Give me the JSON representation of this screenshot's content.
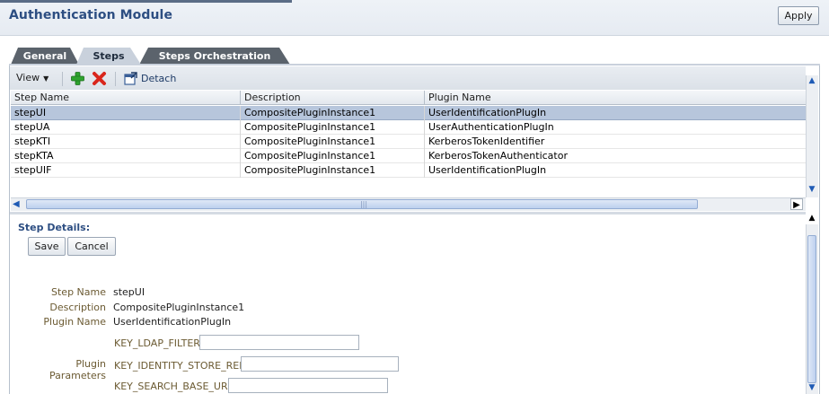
{
  "header": {
    "title": "Authentication Module",
    "apply_label": "Apply"
  },
  "tabs": [
    {
      "label": "General",
      "active": false
    },
    {
      "label": "Steps",
      "active": true
    },
    {
      "label": "Steps Orchestration",
      "active": false
    }
  ],
  "toolbar": {
    "view_label": "View",
    "view_arrow": "▼",
    "detach_label": "Detach"
  },
  "table": {
    "columns": [
      "Step Name",
      "Description",
      "Plugin Name"
    ],
    "rows": [
      {
        "step": "stepUI",
        "description": "CompositePluginInstance1",
        "plugin": "UserIdentificationPlugIn",
        "selected": true
      },
      {
        "step": "stepUA",
        "description": "CompositePluginInstance1",
        "plugin": "UserAuthenticationPlugIn",
        "selected": false
      },
      {
        "step": "stepKTI",
        "description": "CompositePluginInstance1",
        "plugin": "KerberosTokenIdentifier",
        "selected": false
      },
      {
        "step": "stepKTA",
        "description": "CompositePluginInstance1",
        "plugin": "KerberosTokenAuthenticator",
        "selected": false
      },
      {
        "step": "stepUIF",
        "description": "CompositePluginInstance1",
        "plugin": "UserIdentificationPlugIn",
        "selected": false
      }
    ]
  },
  "details": {
    "title": "Step Details:",
    "save_label": "Save",
    "cancel_label": "Cancel",
    "step_name_label": "Step Name",
    "step_name_value": "stepUI",
    "description_label": "Description",
    "description_value": "CompositePluginInstance1",
    "plugin_name_label": "Plugin Name",
    "plugin_name_value": "UserIdentificationPlugIn",
    "plugin_params_label": "Plugin Parameters",
    "params": [
      {
        "key": "KEY_LDAP_FILTER",
        "value": ""
      },
      {
        "key": "KEY_IDENTITY_STORE_REF",
        "value": ""
      },
      {
        "key": "KEY_SEARCH_BASE_URL",
        "value": ""
      }
    ]
  },
  "icons": {
    "add": "add-icon",
    "delete": "delete-icon",
    "detach": "detach-icon"
  },
  "colors": {
    "title": "#2d4e82",
    "selected_row": "#b7c6dc",
    "tab_dark": "#5b636c",
    "add_green": "#2ea32e",
    "delete_red": "#d9261c"
  }
}
